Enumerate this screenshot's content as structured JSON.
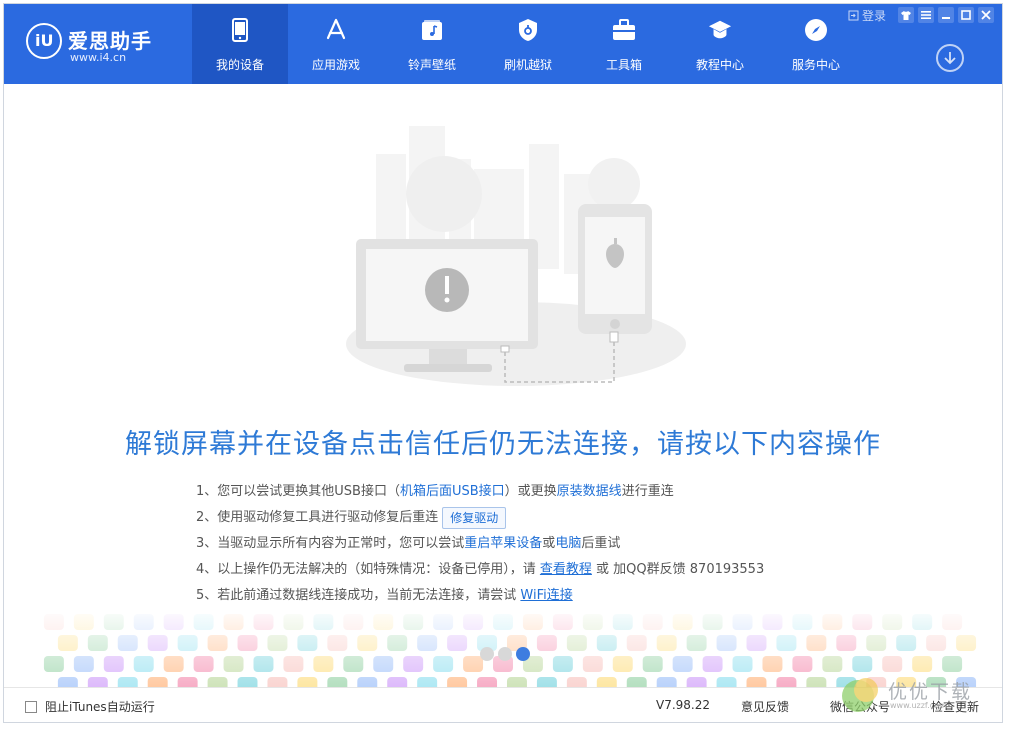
{
  "app": {
    "title": "爱思助手",
    "url": "www.i4.cn"
  },
  "nav": {
    "items": [
      {
        "label": "我的设备",
        "icon": "phone-icon",
        "active": true
      },
      {
        "label": "应用游戏",
        "icon": "app-store-icon"
      },
      {
        "label": "铃声壁纸",
        "icon": "music-note-icon"
      },
      {
        "label": "刷机越狱",
        "icon": "shield-icon"
      },
      {
        "label": "工具箱",
        "icon": "toolbox-icon"
      },
      {
        "label": "教程中心",
        "icon": "graduation-cap-icon"
      },
      {
        "label": "服务中心",
        "icon": "compass-icon"
      }
    ]
  },
  "topbar": {
    "login_label": "登录"
  },
  "main": {
    "headline": "解锁屏幕并在设备点击信任后仍无法连接，请按以下内容操作",
    "steps": {
      "s1": {
        "prefix": "1、您可以尝试更换其他USB接口（",
        "link1": "机箱后面USB接口",
        "mid": "）或更换",
        "link2": "原装数据线",
        "suffix": "进行重连"
      },
      "s2": {
        "prefix": "2、使用驱动修复工具进行驱动修复后重连",
        "button": "修复驱动"
      },
      "s3": {
        "prefix": "3、当驱动显示所有内容为正常时，您可以尝试",
        "link1": "重启苹果设备",
        "mid": "或",
        "link2": "电脑",
        "suffix": "后重试"
      },
      "s4": {
        "prefix": "4、以上操作仍无法解决的（如特殊情况：设备已停用），请 ",
        "link1": "查看教程",
        "suffix": " 或 加QQ群反馈 870193553"
      },
      "s5": {
        "prefix": "5、若此前通过数据线连接成功，当前无法连接，请尝试 ",
        "link1": "WiFi连接"
      }
    }
  },
  "bottom": {
    "itunes_label": "阻止iTunes自动运行",
    "version": "V7.98.22",
    "feedback": "意见反馈",
    "wechat": "微信公众号",
    "update": "检查更新"
  },
  "watermark": {
    "text": "优优下载",
    "sub": "www.uzzf.com"
  },
  "colors": {
    "brand": "#2b6ae0",
    "nav_active": "#1f56c4",
    "headline": "#2e7ad6",
    "link": "#1f6fd6"
  }
}
